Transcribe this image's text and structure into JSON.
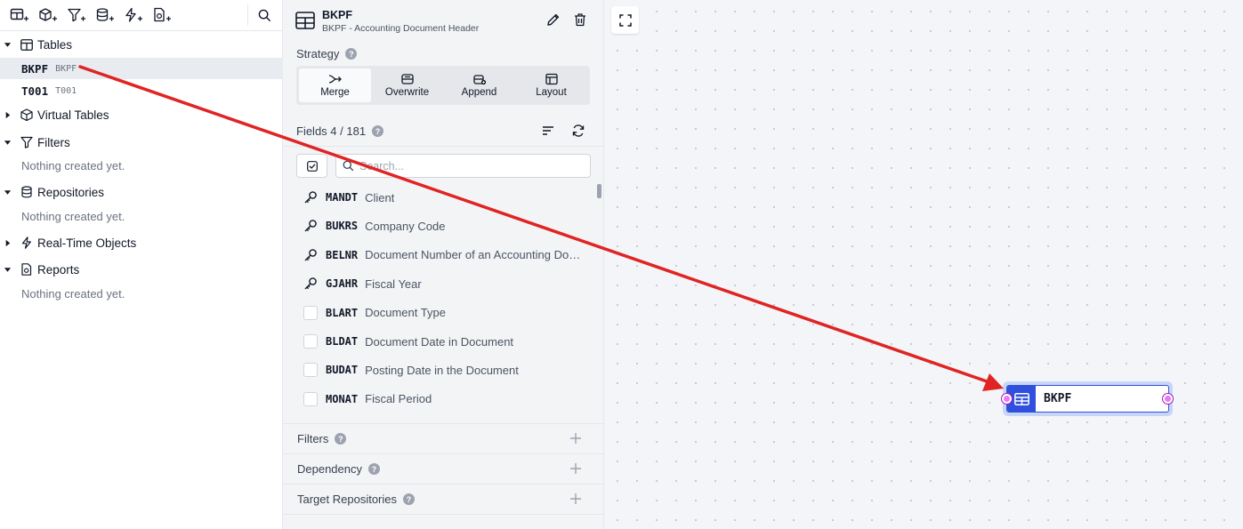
{
  "sidebar": {
    "sections": [
      {
        "label": "Tables",
        "icon": "table-icon"
      },
      {
        "label": "Virtual Tables",
        "icon": "cube-icon"
      },
      {
        "label": "Filters",
        "icon": "filter-icon"
      },
      {
        "label": "Repositories",
        "icon": "database-icon"
      },
      {
        "label": "Real-Time Objects",
        "icon": "bolt-icon"
      },
      {
        "label": "Reports",
        "icon": "report-icon"
      }
    ],
    "tables": [
      {
        "code": "BKPF",
        "sub": "BKPF"
      },
      {
        "code": "T001",
        "sub": "T001"
      }
    ],
    "empty_text": "Nothing created yet."
  },
  "panel": {
    "title": "BKPF",
    "subtitle": "BKPF - Accounting Document Header",
    "strategy_label": "Strategy",
    "strategies": [
      "Merge",
      "Overwrite",
      "Append",
      "Layout"
    ],
    "fields_label": "Fields 4 / 181",
    "search_placeholder": "Search...",
    "fields": [
      {
        "code": "MANDT",
        "desc": "Client",
        "key": true
      },
      {
        "code": "BUKRS",
        "desc": "Company Code",
        "key": true
      },
      {
        "code": "BELNR",
        "desc": "Document Number of an Accounting Document",
        "key": true
      },
      {
        "code": "GJAHR",
        "desc": "Fiscal Year",
        "key": true
      },
      {
        "code": "BLART",
        "desc": "Document Type",
        "key": false
      },
      {
        "code": "BLDAT",
        "desc": "Document Date in Document",
        "key": false
      },
      {
        "code": "BUDAT",
        "desc": "Posting Date in the Document",
        "key": false
      },
      {
        "code": "MONAT",
        "desc": "Fiscal Period",
        "key": false
      }
    ],
    "sections": [
      "Filters",
      "Dependency",
      "Target Repositories"
    ]
  },
  "canvas": {
    "node_label": "BKPF"
  },
  "colors": {
    "accent": "#2f4fdc",
    "annotation_arrow": "#e02424"
  }
}
